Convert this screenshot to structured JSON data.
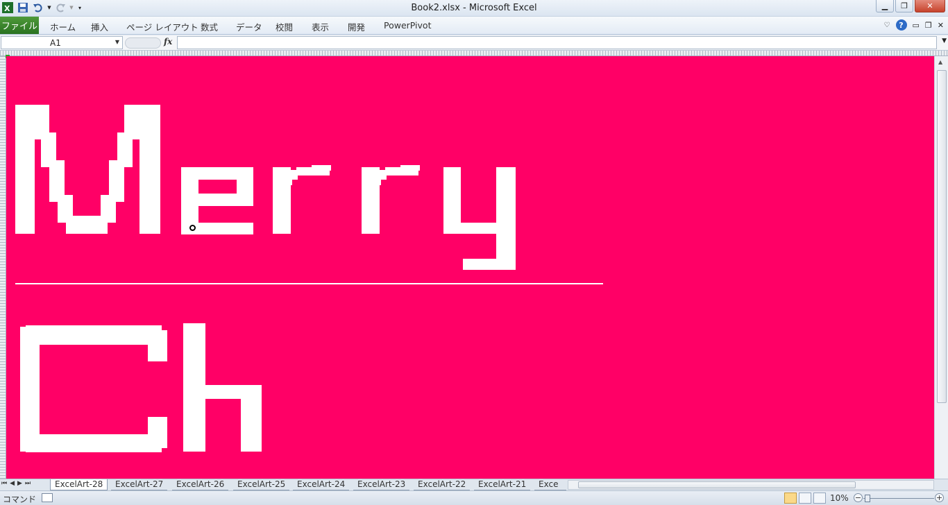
{
  "window": {
    "title": "Book2.xlsx - Microsoft Excel"
  },
  "ribbon": {
    "file_tab": "ファイル",
    "tabs": [
      "ホーム",
      "挿入",
      "ページ レイアウト",
      "数式",
      "データ",
      "校閲",
      "表示",
      "開発",
      "PowerPivot"
    ]
  },
  "formula_bar": {
    "name_box": "A1",
    "fx_label": "fx",
    "formula": ""
  },
  "sheet": {
    "background": "#ff0066",
    "art_color": "#ffffff",
    "art_text": [
      "Merry",
      "Ch"
    ]
  },
  "sheet_tabs": [
    "ExcelArt-28",
    "ExcelArt-27",
    "ExcelArt-26",
    "ExcelArt-25",
    "ExcelArt-24",
    "ExcelArt-23",
    "ExcelArt-22",
    "ExcelArt-21",
    "Exce"
  ],
  "status": {
    "mode": "コマンド",
    "zoom": "10%"
  },
  "colors": {
    "file_tab": "#2a7220",
    "accent": "#ff0066"
  }
}
